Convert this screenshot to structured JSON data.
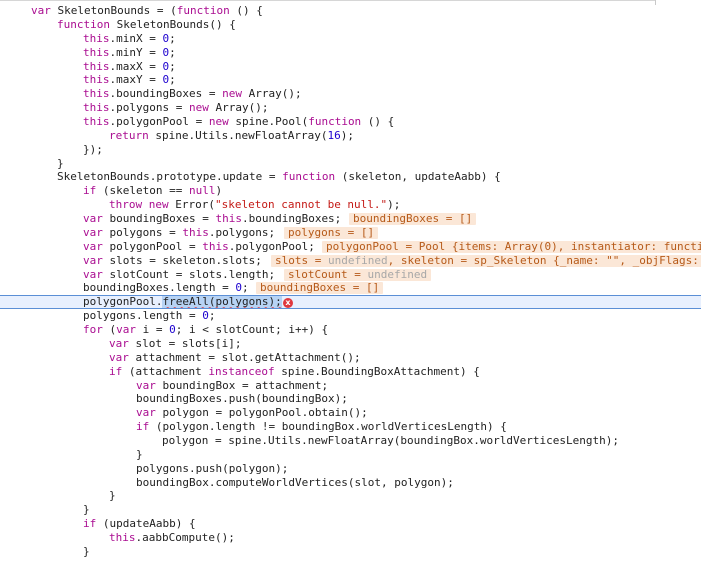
{
  "lines": [
    {
      "segments": [
        [
          "kw",
          "var "
        ],
        [
          "pln",
          "SkeletonBounds = ("
        ],
        [
          "kw",
          "function"
        ],
        [
          "pln",
          " () {"
        ]
      ]
    },
    {
      "segments": [
        [
          "kw",
          "function "
        ],
        [
          "pln",
          "SkeletonBounds() {"
        ]
      ]
    },
    {
      "segments": [
        [
          "this",
          "this"
        ],
        [
          "pln",
          ".minX = "
        ],
        [
          "num",
          "0"
        ],
        [
          "pln",
          ";"
        ]
      ]
    },
    {
      "segments": [
        [
          "this",
          "this"
        ],
        [
          "pln",
          ".minY = "
        ],
        [
          "num",
          "0"
        ],
        [
          "pln",
          ";"
        ]
      ]
    },
    {
      "segments": [
        [
          "this",
          "this"
        ],
        [
          "pln",
          ".maxX = "
        ],
        [
          "num",
          "0"
        ],
        [
          "pln",
          ";"
        ]
      ]
    },
    {
      "segments": [
        [
          "this",
          "this"
        ],
        [
          "pln",
          ".maxY = "
        ],
        [
          "num",
          "0"
        ],
        [
          "pln",
          ";"
        ]
      ]
    },
    {
      "segments": [
        [
          "this",
          "this"
        ],
        [
          "pln",
          ".boundingBoxes = "
        ],
        [
          "kw",
          "new "
        ],
        [
          "pln",
          "Array();"
        ]
      ]
    },
    {
      "segments": [
        [
          "this",
          "this"
        ],
        [
          "pln",
          ".polygons = "
        ],
        [
          "kw",
          "new "
        ],
        [
          "pln",
          "Array();"
        ]
      ]
    },
    {
      "segments": [
        [
          "this",
          "this"
        ],
        [
          "pln",
          ".polygonPool = "
        ],
        [
          "kw",
          "new "
        ],
        [
          "pln",
          "spine.Pool("
        ],
        [
          "kw",
          "function"
        ],
        [
          "pln",
          " () {"
        ]
      ]
    },
    {
      "segments": [
        [
          "kw",
          "return "
        ],
        [
          "pln",
          "spine.Utils.newFloatArray("
        ],
        [
          "num",
          "16"
        ],
        [
          "pln",
          ");"
        ]
      ]
    },
    {
      "segments": [
        [
          "pln",
          "});"
        ]
      ]
    },
    {
      "segments": [
        [
          "pln",
          "}"
        ]
      ]
    },
    {
      "segments": [
        [
          "pln",
          "SkeletonBounds.prototype.update = "
        ],
        [
          "kw",
          "function"
        ],
        [
          "pln",
          " (skeleton, updateAabb) {"
        ]
      ]
    },
    {
      "segments": [
        [
          "kw",
          "if "
        ],
        [
          "pln",
          "(skeleton == "
        ],
        [
          "kw",
          "null"
        ],
        [
          "pln",
          ")"
        ]
      ]
    },
    {
      "segments": [
        [
          "kw",
          "throw new "
        ],
        [
          "pln",
          "Error("
        ],
        [
          "str",
          "\"skeleton cannot be null.\""
        ],
        [
          "pln",
          ");"
        ]
      ]
    },
    {
      "segments": [
        [
          "kw",
          "var "
        ],
        [
          "pln",
          "boundingBoxes = "
        ],
        [
          "this",
          "this"
        ],
        [
          "pln",
          ".boundingBoxes;"
        ]
      ],
      "inline": "boundingBoxes = []"
    },
    {
      "segments": [
        [
          "kw",
          "var "
        ],
        [
          "pln",
          "polygons = "
        ],
        [
          "this",
          "this"
        ],
        [
          "pln",
          ".polygons;"
        ]
      ],
      "inline": "polygons = []"
    },
    {
      "segments": [
        [
          "kw",
          "var "
        ],
        [
          "pln",
          "polygonPool = "
        ],
        [
          "this",
          "this"
        ],
        [
          "pln",
          ".polygonPool;"
        ]
      ],
      "inline": "polygonPool = Pool {items: Array(0), instantiator: functi"
    },
    {
      "segments": [
        [
          "kw",
          "var "
        ],
        [
          "pln",
          "slots = skeleton.slots;"
        ]
      ],
      "inline": "slots = undefined, skeleton = sp_Skeleton {_name: \"\", _objFlags:"
    },
    {
      "segments": [
        [
          "kw",
          "var "
        ],
        [
          "pln",
          "slotCount = slots.length;"
        ]
      ],
      "inline": "slotCount = undefined"
    },
    {
      "segments": [
        [
          "pln",
          "boundingBoxes.length = "
        ],
        [
          "num",
          "0"
        ],
        [
          "pln",
          ";"
        ]
      ],
      "inline": "boundingBoxes = []"
    },
    {
      "segments": [
        [
          "pln",
          "polygonPool."
        ],
        [
          "sel",
          "freeAll(polygons);"
        ]
      ],
      "error": "x"
    },
    {
      "segments": [
        [
          "pln",
          "polygons.length = "
        ],
        [
          "num",
          "0"
        ],
        [
          "pln",
          ";"
        ]
      ]
    },
    {
      "segments": [
        [
          "kw",
          "for "
        ],
        [
          "pln",
          "("
        ],
        [
          "kw",
          "var "
        ],
        [
          "pln",
          "i = "
        ],
        [
          "num",
          "0"
        ],
        [
          "pln",
          "; i < slotCount; i++) {"
        ]
      ]
    },
    {
      "segments": [
        [
          "kw",
          "var "
        ],
        [
          "pln",
          "slot = slots[i];"
        ]
      ]
    },
    {
      "segments": [
        [
          "kw",
          "var "
        ],
        [
          "pln",
          "attachment = slot.getAttachment();"
        ]
      ]
    },
    {
      "segments": [
        [
          "kw",
          "if "
        ],
        [
          "pln",
          "(attachment "
        ],
        [
          "kw",
          "instanceof "
        ],
        [
          "pln",
          "spine.BoundingBoxAttachment) {"
        ]
      ]
    },
    {
      "segments": [
        [
          "kw",
          "var "
        ],
        [
          "pln",
          "boundingBox = attachment;"
        ]
      ]
    },
    {
      "segments": [
        [
          "pln",
          "boundingBoxes.push(boundingBox);"
        ]
      ]
    },
    {
      "segments": [
        [
          "kw",
          "var "
        ],
        [
          "pln",
          "polygon = polygonPool.obtain();"
        ]
      ]
    },
    {
      "segments": [
        [
          "kw",
          "if "
        ],
        [
          "pln",
          "(polygon.length != boundingBox.worldVerticesLength) {"
        ]
      ]
    },
    {
      "segments": [
        [
          "pln",
          "polygon = spine.Utils.newFloatArray(boundingBox.worldVerticesLength);"
        ]
      ]
    },
    {
      "segments": [
        [
          "pln",
          "}"
        ]
      ]
    },
    {
      "segments": [
        [
          "pln",
          "polygons.push(polygon);"
        ]
      ]
    },
    {
      "segments": [
        [
          "pln",
          "boundingBox.computeWorldVertices(slot, polygon);"
        ]
      ]
    },
    {
      "segments": [
        [
          "pln",
          "}"
        ]
      ]
    },
    {
      "segments": [
        [
          "pln",
          "}"
        ]
      ]
    },
    {
      "segments": [
        [
          "kw",
          "if "
        ],
        [
          "pln",
          "(updateAabb) {"
        ]
      ]
    },
    {
      "segments": [
        [
          "this",
          "this"
        ],
        [
          "pln",
          ".aabbCompute();"
        ]
      ]
    },
    {
      "segments": [
        [
          "pln",
          "}"
        ]
      ]
    }
  ]
}
